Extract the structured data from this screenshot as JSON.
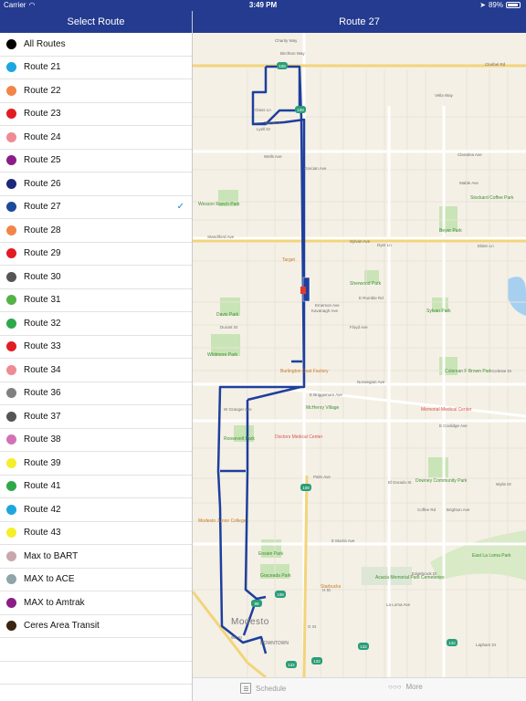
{
  "status": {
    "carrier": "Carrier",
    "time": "3:49 PM",
    "battery": "89%",
    "battery_level": 0.89
  },
  "sidebar": {
    "title": "Select Route",
    "selected_index": 7,
    "routes": [
      {
        "label": "All Routes",
        "color": "#000000"
      },
      {
        "label": "Route 21",
        "color": "#1ea6e0"
      },
      {
        "label": "Route 22",
        "color": "#f2854a"
      },
      {
        "label": "Route 23",
        "color": "#e21c23"
      },
      {
        "label": "Route 24",
        "color": "#ee8b93"
      },
      {
        "label": "Route 25",
        "color": "#8b1e86"
      },
      {
        "label": "Route 26",
        "color": "#1c2a78"
      },
      {
        "label": "Route 27",
        "color": "#1e4a9a"
      },
      {
        "label": "Route 28",
        "color": "#f2854a"
      },
      {
        "label": "Route 29",
        "color": "#e21c23"
      },
      {
        "label": "Route 30",
        "color": "#555555"
      },
      {
        "label": "Route 31",
        "color": "#55b246"
      },
      {
        "label": "Route 32",
        "color": "#2fa84a"
      },
      {
        "label": "Route 33",
        "color": "#e21c23"
      },
      {
        "label": "Route 34",
        "color": "#ee8b93"
      },
      {
        "label": "Route 36",
        "color": "#808080"
      },
      {
        "label": "Route 37",
        "color": "#555555"
      },
      {
        "label": "Route 38",
        "color": "#d272b4"
      },
      {
        "label": "Route 39",
        "color": "#f5ee2b"
      },
      {
        "label": "Route 41",
        "color": "#2fa84a"
      },
      {
        "label": "Route 42",
        "color": "#1ea6e0"
      },
      {
        "label": "Route 43",
        "color": "#f5ee2b"
      },
      {
        "label": "Max to BART",
        "color": "#c9a7ae"
      },
      {
        "label": "MAX to ACE",
        "color": "#8fa5ab"
      },
      {
        "label": "MAX to Amtrak",
        "color": "#8b1e86"
      },
      {
        "label": "Ceres Area Transit",
        "color": "#3a2510"
      }
    ]
  },
  "map": {
    "title": "Route 27",
    "route_color": "#1e3f9c",
    "streets": {
      "charity": "Charity Way",
      "birchton": "Birchton Way",
      "claribel": "Claribel Rd",
      "vella": "Vella Way",
      "glass": "Glass Ln",
      "tango": "Tango Dr",
      "lyell": "Lyell Dr",
      "wells": "Wells Ave",
      "grecian": "Grecian Ave",
      "claratina": "Claratina Ave",
      "mable": "Mable Ave",
      "standiford": "Standiford Ave",
      "sylvan": "Sylvan Ave",
      "dyer": "Dyer Ln",
      "elden": "Elden Ln",
      "emerson": "Emerson Ave",
      "kavanagh": "Kavanagh Ave",
      "erumble": "E Rumble Rd",
      "floyd": "Floyd Ave",
      "durant": "Durant St",
      "norwegian": "Norwegian Ave",
      "ebriggsmore": "E Briggsmore Ave",
      "wgranger": "W Granger Ave",
      "ecoolidge": "E Coolidge Ave",
      "palm": "Palm Ave",
      "emorris": "E Morris Ave",
      "laloma": "La Loma Ave",
      "edgebrook": "Edgebrook Dr",
      "celeste": "Celeste Dr",
      "wylie": "Wylie Dr",
      "lapham": "Lapham Dr",
      "eldorado": "El Dorado St",
      "brighton": "Brighton Ave",
      "coffee": "Coffee Rd",
      "ninth": "9th St",
      "hst": "H St",
      "gst": "G St"
    },
    "parks": {
      "wesson": "Wesson Ranch Park",
      "stockard": "Stockard Coffee Park",
      "beyer": "Beyer Park",
      "sherwood": "Sherwood Park",
      "davis": "Davis Park",
      "sylvan": "Sylvan Park",
      "whitmore": "Whitmore Park",
      "coleman": "Coleman F Brown Park",
      "mchenry": "McHenry Village",
      "roosevelt": "Roosevelt Park",
      "downey": "Downey Community Park",
      "ensien": "Ensien Park",
      "graceada": "Graceada Park",
      "eastlaloma": "East La Loma Park",
      "acacia": "Acacia Memorial Park Cemeteries"
    },
    "pois": {
      "target": "Target",
      "burlington": "Burlington Coat Factory",
      "starbucks": "Starbucks",
      "mjc": "Modesto Junior College"
    },
    "medical": {
      "memorial": "Memorial Medical Center",
      "doctors": "Doctors Medical Center"
    },
    "city": "Modesto",
    "downtown": "DOWNTOWN",
    "shields": {
      "s108a": "108",
      "s108b": "108",
      "s108c": "108",
      "s108d": "108",
      "s132a": "132",
      "s132b": "132",
      "s132c": "132",
      "s132d": "132",
      "s99": "99"
    }
  },
  "toolbar": {
    "schedule": "Schedule",
    "more": "More"
  }
}
